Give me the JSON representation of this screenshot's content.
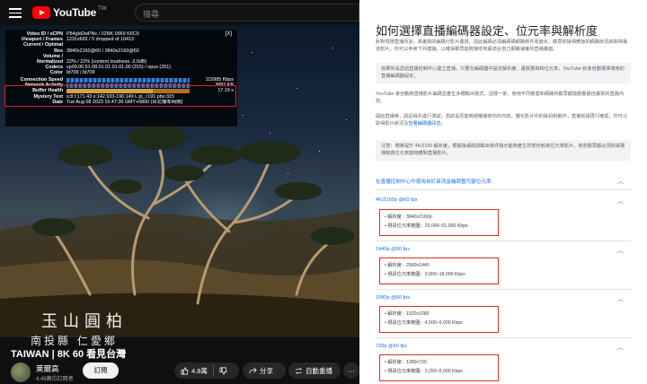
{
  "youtube": {
    "logo_text": "YouTube",
    "logo_region": "TW",
    "search_placeholder": "搜尋",
    "stats": {
      "close": "[X]",
      "rows": [
        {
          "k": "Video ID / sCPN",
          "v": "P84gId2wPNc  /  02NK  0969  K6C9"
        },
        {
          "k": "Viewport / Frames",
          "v": "1231x692 / 0 dropped of 10413"
        },
        {
          "k": "Current / Optimal",
          "v": ""
        },
        {
          "k": "Res",
          "v": "3840x2160@60 / 3840x2160@60"
        },
        {
          "k": "Volume /",
          "v": ""
        },
        {
          "k": "Normalized",
          "v": "22% / 22% (content loudness -3.0dB)"
        },
        {
          "k": "Codecs",
          "v": "vp09.00.51.08.01.01.01.01.00 (315) / opus (251)"
        },
        {
          "k": "Color",
          "v": "bt709 / bt709"
        }
      ],
      "graph_rows": [
        {
          "k": "Connection Speed",
          "v": "115985 Kbps",
          "style": "cs"
        },
        {
          "k": "Network Activity",
          "v": "3882 KB",
          "style": "na"
        },
        {
          "k": "Buffer Health",
          "v": "17.19 s",
          "style": "bh"
        }
      ],
      "tail_rows": [
        {
          "k": "Mystery Text",
          "v": "s:8 t:171.43 s:142.933-190.149 L pl_i:191 pbs:315"
        },
        {
          "k": "Date",
          "v": "Tue Aug 08 2023 15:47:36 GMT+0800 (台北標準時間)"
        }
      ]
    },
    "caption_main": "玉山圓柏",
    "caption_sub": "南投縣 仁愛鄉",
    "video_title": "TAIWAN | 8K 60 看見台灣",
    "channel_name": "萊爾高",
    "subscribers": "4.49萬位訂閱者",
    "subscribe_label": "訂閱",
    "like_count": "4.8萬",
    "share_label": "分享",
    "repeat_label": "自動重播",
    "more_label": "⋯"
  },
  "help": {
    "title": "如何選擇直播編碼器設定、位元率與解析度",
    "intro": "針對現場直播而言，高畫質的編碼分影片畫質、因此編碼必須編碼碼網路條件而變化、觀眾依據相應後的網路狀況來取得最佳影片。你可以參考下列建議，以確保觀眾能夠接收到最適合自己網路速度的直播畫面。",
    "note1": "如果你是透過直播控制中心建立直播，只要在編碼器中設定解析度、畫質要高和位元率，YouTube 就會自動選擇適用的直播編碼器設定。",
    "para2": "YouTube 會自動將直播影片編碼並產生多種輸出格式，這樣一來，使用不同裝置和網路的觀眾都能觀看最佳畫質的直播內容。",
    "para3_a": "開始直播時，請記得先進行測試，測試是否能夠順暢播放你的內容。優化影片中的資訊和動作，直播前請再行確認，你可以取得影片狀況及",
    "para3_link": "查看編碼器訊息",
    "para3_b": "。",
    "note2": "注意：簡單提升 4K/2160 解析度，根據後續前該輸出條件指示能夠產生的部份較高位元率影片，有些觀眾都必須依據選擇較高位元率能夠應對直播影片。",
    "settings_link": "在直播控制中心中使用自訂串流金鑰調整可變位元率",
    "sections": [
      {
        "title": "4K/2160p @60 fps",
        "resolution_label": "解析度：3840x2160p",
        "bitrate_label": "視訊位元率範圍：20,000–51,000 Kbps"
      },
      {
        "title": "1440p @60 fps",
        "resolution_label": "解析度：2560x1440",
        "bitrate_label": "視訊位元率範圍：9,000–18,000 Kbps"
      },
      {
        "title": "1080p @60 fps",
        "resolution_label": "解析度：1920x1080",
        "bitrate_label": "視訊位元率範圍：4,500–9,000 Kbps"
      },
      {
        "title": "720p @60 fps",
        "resolution_label": "解析度：1280x720",
        "bitrate_label": "視訊位元率範圍：2,250–6,000 Kbps"
      }
    ]
  },
  "colors": {
    "youtube_red": "#ff0000",
    "highlight_box": "#d93025",
    "link_blue": "#1a73e8"
  }
}
